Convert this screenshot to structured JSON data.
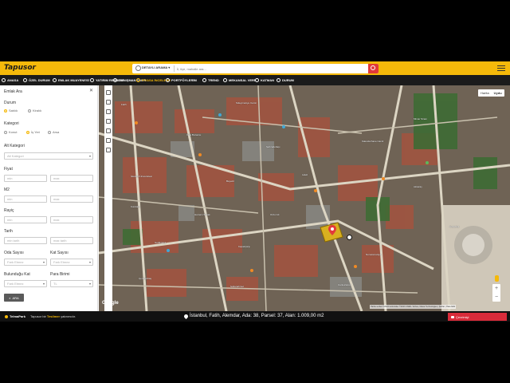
{
  "app": {
    "logo": "Tapusor"
  },
  "search": {
    "type_label": "DETAYLI ARAMA ▾",
    "placeholder": "İl, ilçe, mahalle ara..."
  },
  "nav": [
    {
      "label": "ANASA",
      "icon": "home-icon"
    },
    {
      "label": "ÖZEL DURUM",
      "icon": "pin-icon"
    },
    {
      "label": "EMLAK MUAYENESİ",
      "icon": "search-icon"
    },
    {
      "label": "YATIRIM REHBERİ",
      "icon": "chart-icon"
    },
    {
      "label": "DANIŞMAN ÖNER",
      "icon": "user-icon"
    },
    {
      "label": "PİYASA İNCELEME",
      "icon": "eye-icon",
      "active": true
    },
    {
      "label": "PORTFÖYLERİM",
      "icon": "folder-icon"
    },
    {
      "label": "TREND",
      "icon": "trend-icon"
    },
    {
      "label": "MEKANSAL VERİ",
      "icon": "layers-icon"
    },
    {
      "label": "KATMAN",
      "icon": "stack-icon"
    },
    {
      "label": "DURUM",
      "icon": "info-icon"
    }
  ],
  "panel": {
    "title": "Emlak Ara",
    "durum_label": "Durum",
    "durum_options": [
      "Satılık",
      "Kiralık"
    ],
    "kategori_label": "Kategori",
    "kategori_options": [
      "Konut",
      "İş Yeri",
      "Arsa"
    ],
    "alt_kategori_label": "Alt Kategori",
    "alt_kategori_value": "Alt Kategori",
    "fiyat_label": "Fiyat",
    "m2_label": "M2",
    "rayic_label": "Rayiç",
    "tarih_label": "Tarih",
    "min": "min",
    "max": "max",
    "min_tarih": "min tarih",
    "max_tarih": "max tarih",
    "oda_label": "Oda Sayısı",
    "kat_label": "Kat Sayısı",
    "bulundugu_label": "Bulunduğu Kat",
    "para_label": "Para Birimi",
    "fark_etmez": "Fark Etmez",
    "para_value": "TL",
    "ara_button": "ARA"
  },
  "map": {
    "type_harita": "Harita",
    "type_uydu": "Uydu",
    "google": "Google",
    "credit": "Harita verileri ©2023 Görüntüler ©2023 CNES / Airbus, Maxar Technologies | Şartlar | Hata bildir",
    "labels": [
      "Fatih",
      "Süleymaniye Camii",
      "Vefa Bozacısı",
      "Şehzadebaşı",
      "Kalenderhane Camii",
      "İstanbul Üniversitesi",
      "Beyazıt",
      "Laleli",
      "Aksaray",
      "Kumkapı",
      "Hamam Sokak",
      "Ordu Cd.",
      "Gedikpaşa",
      "Kapalıçarşı",
      "Nuruosmaniye",
      "Çemberlitaş",
      "Sultanahmet",
      "Cankurtaran",
      "Mimar Sinan",
      "Ayasofya"
    ]
  },
  "footer": {
    "brand": "TelmaPark",
    "tag_prefix": "Tapusor bir",
    "tag_brand": "Tesilmer",
    "tag_suffix": "yatırımıdır.",
    "parcel_info": "İstanbul, Fatih, Alemdar, Ada: 38, Parsel: 37, Alan: 1.009,00 m2",
    "chat_label": "Çevrimiçi"
  },
  "colors": {
    "brand": "#f5b90a",
    "nav_bg": "#1b1b1b",
    "marker": "#e23a3a",
    "parcel_fill": "#d8b020"
  }
}
